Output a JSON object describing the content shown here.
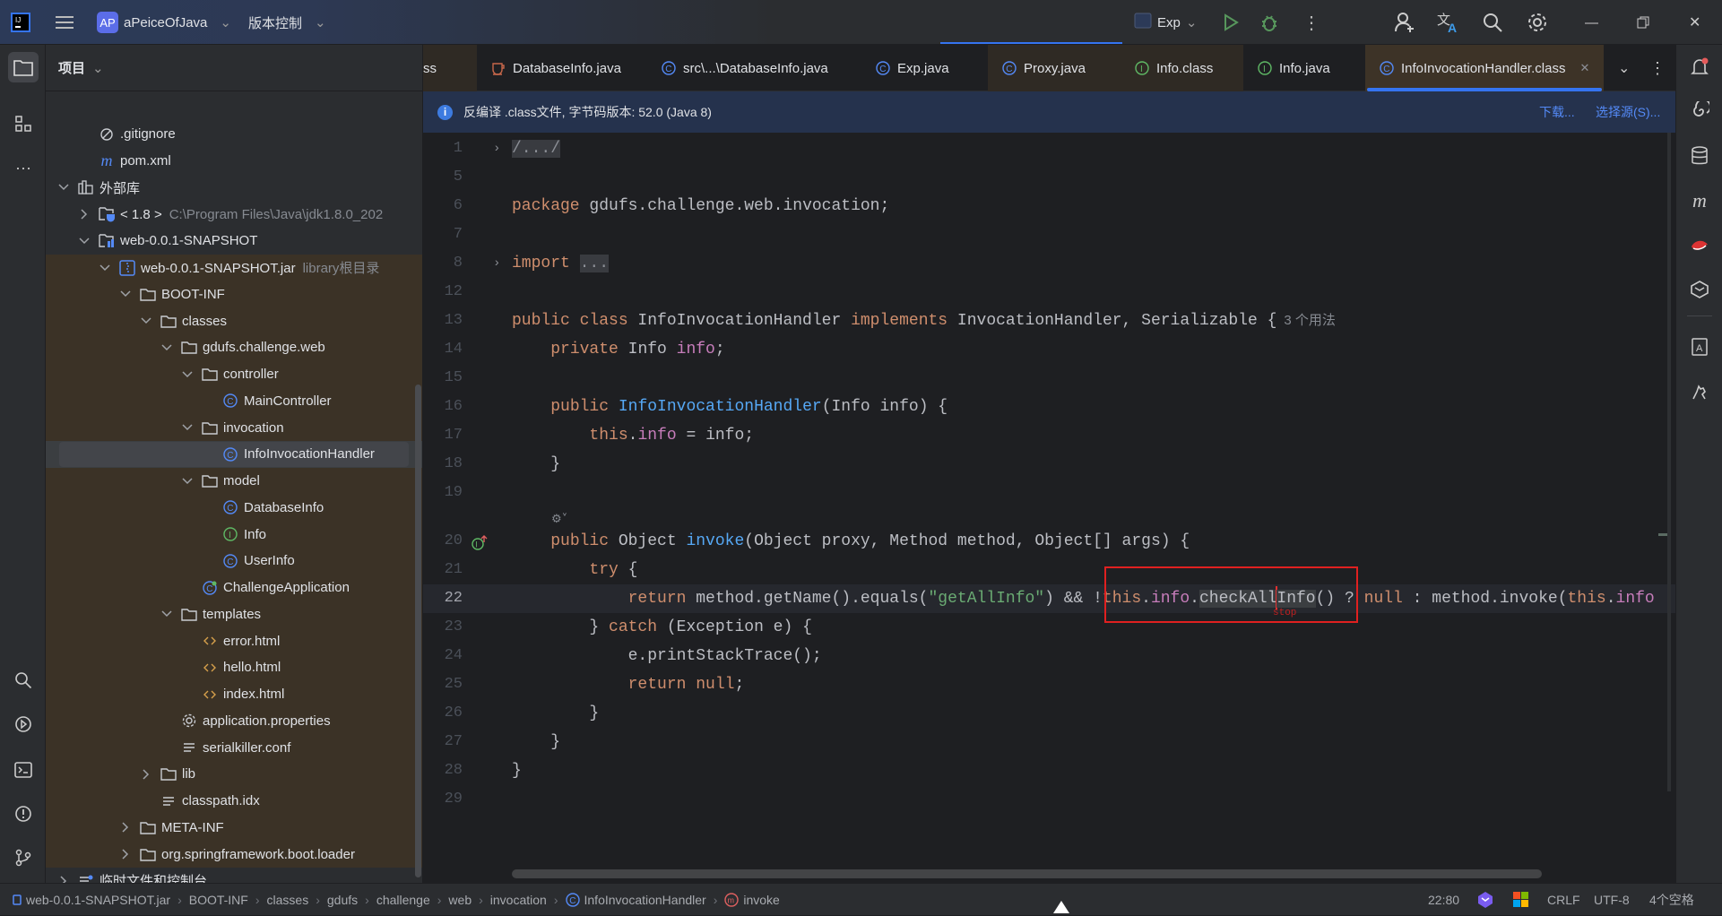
{
  "titlebar": {
    "project_badge": "AP",
    "project_name": "aPeiceOfJava",
    "vcs_menu": "版本控制",
    "run_config": "Exp"
  },
  "project_panel": {
    "title": "项目",
    "tree": [
      {
        "label": ".gitignore",
        "level": 1,
        "chevron": null,
        "icon": "ignore-file-icon"
      },
      {
        "label": "pom.xml",
        "level": 1,
        "chevron": null,
        "icon": "maven-icon"
      },
      {
        "label": "外部库",
        "level": 0,
        "chevron": "down",
        "icon": "library-icon"
      },
      {
        "label": "< 1.8 >",
        "hint": "C:\\Program Files\\Java\\jdk1.8.0_202",
        "level": 1,
        "chevron": "right",
        "icon": "jdk-folder-icon"
      },
      {
        "label": "web-0.0.1-SNAPSHOT",
        "level": 1,
        "chevron": "down",
        "icon": "library-folder-icon"
      },
      {
        "label": "web-0.0.1-SNAPSHOT.jar",
        "hint": "library根目录",
        "level": 2,
        "chevron": "down",
        "icon": "jar-icon"
      },
      {
        "label": "BOOT-INF",
        "level": 3,
        "chevron": "down",
        "icon": "folder-icon"
      },
      {
        "label": "classes",
        "level": 4,
        "chevron": "down",
        "icon": "folder-icon"
      },
      {
        "label": "gdufs.challenge.web",
        "level": 5,
        "chevron": "down",
        "icon": "folder-icon"
      },
      {
        "label": "controller",
        "level": 6,
        "chevron": "down",
        "icon": "folder-icon"
      },
      {
        "label": "MainController",
        "level": 7,
        "chevron": null,
        "icon": "class-icon"
      },
      {
        "label": "invocation",
        "level": 6,
        "chevron": "down",
        "icon": "folder-icon"
      },
      {
        "label": "InfoInvocationHandler",
        "level": 7,
        "chevron": null,
        "icon": "class-icon",
        "selected": true
      },
      {
        "label": "model",
        "level": 6,
        "chevron": "down",
        "icon": "folder-icon"
      },
      {
        "label": "DatabaseInfo",
        "level": 7,
        "chevron": null,
        "icon": "class-icon"
      },
      {
        "label": "Info",
        "level": 7,
        "chevron": null,
        "icon": "interface-icon"
      },
      {
        "label": "UserInfo",
        "level": 7,
        "chevron": null,
        "icon": "class-icon"
      },
      {
        "label": "ChallengeApplication",
        "level": 6,
        "chevron": null,
        "icon": "spring-class-icon"
      },
      {
        "label": "templates",
        "level": 5,
        "chevron": "down",
        "icon": "folder-icon"
      },
      {
        "label": "error.html",
        "level": 6,
        "chevron": null,
        "icon": "html-icon"
      },
      {
        "label": "hello.html",
        "level": 6,
        "chevron": null,
        "icon": "html-icon"
      },
      {
        "label": "index.html",
        "level": 6,
        "chevron": null,
        "icon": "html-icon"
      },
      {
        "label": "application.properties",
        "level": 5,
        "chevron": null,
        "icon": "properties-icon"
      },
      {
        "label": "serialkiller.conf",
        "level": 5,
        "chevron": null,
        "icon": "text-file-icon"
      },
      {
        "label": "lib",
        "level": 4,
        "chevron": "right",
        "icon": "folder-icon"
      },
      {
        "label": "classpath.idx",
        "level": 4,
        "chevron": null,
        "icon": "text-file-icon"
      },
      {
        "label": "META-INF",
        "level": 3,
        "chevron": "right",
        "icon": "folder-icon"
      },
      {
        "label": "org.springframework.boot.loader",
        "level": 3,
        "chevron": "right",
        "icon": "folder-icon"
      },
      {
        "label": "临时文件和控制台",
        "level": 0,
        "chevron": "right",
        "icon": "scratches-icon"
      }
    ]
  },
  "tabs": [
    {
      "label": "ss",
      "icon": null,
      "style": "brown"
    },
    {
      "label": "DatabaseInfo.java",
      "icon": "java-cup-icon",
      "style": ""
    },
    {
      "label": "src\\...\\DatabaseInfo.java",
      "icon": "class-icon",
      "style": ""
    },
    {
      "label": "Exp.java",
      "icon": "class-icon",
      "style": ""
    },
    {
      "label": "Proxy.java",
      "icon": "class-icon",
      "style": "brown"
    },
    {
      "label": "Info.class",
      "icon": "interface-icon",
      "style": "brown"
    },
    {
      "label": "Info.java",
      "icon": "interface-icon",
      "style": ""
    },
    {
      "label": "InfoInvocationHandler.class",
      "icon": "class-icon",
      "style": "active"
    }
  ],
  "banner": {
    "message": "反编译 .class文件, 字节码版本: 52.0 (Java 8)",
    "download": "下载...",
    "choose_source": "选择源(S)..."
  },
  "editor": {
    "current_line": 22,
    "annotation_label": "stop",
    "lines": [
      {
        "n": 1,
        "indent": 0,
        "fold": true,
        "tokens": [
          [
            "fold",
            "/.../"
          ]
        ]
      },
      {
        "n": 5,
        "indent": 0,
        "tokens": []
      },
      {
        "n": 6,
        "indent": 0,
        "tokens": [
          [
            "kw",
            "package"
          ],
          [
            "",
            " gdufs.challenge.web.invocation;"
          ]
        ]
      },
      {
        "n": 7,
        "indent": 0,
        "tokens": []
      },
      {
        "n": 8,
        "indent": 0,
        "fold": true,
        "tokens": [
          [
            "kw",
            "import"
          ],
          [
            "",
            " "
          ],
          [
            "fold",
            "..."
          ]
        ]
      },
      {
        "n": 12,
        "indent": 0,
        "tokens": []
      },
      {
        "n": 13,
        "indent": 0,
        "tokens": [
          [
            "kw",
            "public class"
          ],
          [
            "",
            " InfoInvocationHandler "
          ],
          [
            "kw",
            "implements"
          ],
          [
            "",
            " InvocationHandler, Serializable {"
          ]
        ],
        "usage": "3 个用法"
      },
      {
        "n": 14,
        "indent": 1,
        "tokens": [
          [
            "kw",
            "private"
          ],
          [
            "",
            " Info "
          ],
          [
            "fld",
            "info"
          ],
          [
            "",
            ";"
          ]
        ]
      },
      {
        "n": 15,
        "indent": 0,
        "tokens": []
      },
      {
        "n": 16,
        "indent": 1,
        "tokens": [
          [
            "kw",
            "public"
          ],
          [
            "",
            " "
          ],
          [
            "fn",
            "InfoInvocationHandler"
          ],
          [
            "",
            "(Info info) {"
          ]
        ]
      },
      {
        "n": 17,
        "indent": 2,
        "tokens": [
          [
            "kw",
            "this"
          ],
          [
            "",
            "."
          ],
          [
            "fld",
            "info"
          ],
          [
            "",
            " = info;"
          ]
        ]
      },
      {
        "n": 18,
        "indent": 1,
        "tokens": [
          [
            "",
            "}"
          ]
        ]
      },
      {
        "n": 19,
        "indent": 0,
        "tokens": []
      },
      {
        "n": 20,
        "indent": 1,
        "inlay": true,
        "override": true,
        "tokens": [
          [
            "kw",
            "public"
          ],
          [
            "",
            " Object "
          ],
          [
            "fn",
            "invoke"
          ],
          [
            "",
            "(Object proxy, Method method, Object[] args) {"
          ]
        ]
      },
      {
        "n": 21,
        "indent": 2,
        "tokens": [
          [
            "kw",
            "try"
          ],
          [
            "",
            " {"
          ]
        ]
      },
      {
        "n": 22,
        "indent": 3,
        "tokens": [
          [
            "kw",
            "return"
          ],
          [
            "",
            " method.getName().equals("
          ],
          [
            "str",
            "\"getAllInfo\""
          ],
          [
            "",
            ") && !"
          ],
          [
            "kw",
            "this"
          ],
          [
            "",
            "."
          ],
          [
            "fld",
            "info"
          ],
          [
            "",
            "."
          ],
          [
            "sel",
            "checkAll"
          ],
          [
            "caret",
            ""
          ],
          [
            "sel",
            "Info"
          ],
          [
            "",
            "() ? "
          ],
          [
            "kw",
            "null"
          ],
          [
            "",
            " : method.invoke("
          ],
          [
            "kw",
            "this"
          ],
          [
            "",
            "."
          ],
          [
            "fld",
            "info"
          ]
        ]
      },
      {
        "n": 23,
        "indent": 2,
        "tokens": [
          [
            "",
            "} "
          ],
          [
            "kw",
            "catch"
          ],
          [
            "",
            " (Exception e) {"
          ]
        ]
      },
      {
        "n": 24,
        "indent": 3,
        "tokens": [
          [
            "",
            "e.printStackTrace();"
          ]
        ]
      },
      {
        "n": 25,
        "indent": 3,
        "tokens": [
          [
            "kw",
            "return null"
          ],
          [
            "",
            ";"
          ]
        ]
      },
      {
        "n": 26,
        "indent": 2,
        "tokens": [
          [
            "",
            "}"
          ]
        ]
      },
      {
        "n": 27,
        "indent": 1,
        "tokens": [
          [
            "",
            "}"
          ]
        ]
      },
      {
        "n": 28,
        "indent": 0,
        "tokens": [
          [
            "",
            "}"
          ]
        ]
      },
      {
        "n": 29,
        "indent": 0,
        "tokens": []
      }
    ]
  },
  "statusbar": {
    "breadcrumbs": [
      {
        "label": "web-0.0.1-SNAPSHOT.jar",
        "icon": "jar-small-icon"
      },
      {
        "label": "BOOT-INF"
      },
      {
        "label": "classes"
      },
      {
        "label": "gdufs"
      },
      {
        "label": "challenge"
      },
      {
        "label": "web"
      },
      {
        "label": "invocation"
      },
      {
        "label": "InfoInvocationHandler",
        "icon": "class-icon"
      },
      {
        "label": "invoke",
        "icon": "method-icon"
      }
    ],
    "position": "22:80",
    "line_separator": "CRLF",
    "encoding": "UTF-8",
    "indent": "4个空格"
  },
  "colors": {
    "accent": "#3574f0",
    "keyword": "#cf8e6d",
    "field": "#c77dbb",
    "method": "#56a8f5",
    "string": "#6aab73",
    "annotation_box": "#e02020",
    "library_tint": "#3b3226"
  }
}
